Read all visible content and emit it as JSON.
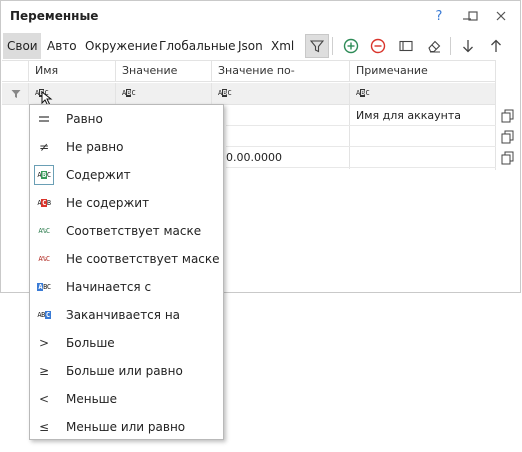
{
  "window": {
    "title": "Переменные",
    "help": "?",
    "colors": {
      "accent": "#2e8b57",
      "danger": "#d9342b",
      "pressed": "#dedede"
    }
  },
  "tabs": [
    "Свои",
    "Авто",
    "Окружение",
    "Глобальные",
    "Json",
    "Xml"
  ],
  "columns": [
    "Имя",
    "Значение",
    "Значение по-умолчанию",
    "Примечание"
  ],
  "rows": [
    {
      "default": "",
      "note": "Имя для аккаунта"
    },
    {
      "default": "",
      "note": ""
    },
    {
      "default": "0.00.0000",
      "note": ""
    }
  ],
  "menu": [
    {
      "icon": "equals-icon",
      "glyph": "═",
      "label": "Равно"
    },
    {
      "icon": "not-equals-icon",
      "glyph": "≠",
      "label": "Не равно"
    },
    {
      "icon": "contains-icon",
      "glyph": "ABC",
      "label": "Содержит"
    },
    {
      "icon": "not-contains-icon",
      "glyph": "ABC",
      "label": "Не содержит"
    },
    {
      "icon": "mask-icon",
      "glyph": "A%C",
      "label": "Соответствует маске"
    },
    {
      "icon": "not-mask-icon",
      "glyph": "A%C",
      "label": "Не соответствует маске"
    },
    {
      "icon": "starts-with-icon",
      "glyph": "ABC",
      "label": "Начинается с"
    },
    {
      "icon": "ends-with-icon",
      "glyph": "ABC",
      "label": "Заканчивается на"
    },
    {
      "icon": "greater-icon",
      "glyph": ">",
      "label": "Больше"
    },
    {
      "icon": "greater-equal-icon",
      "glyph": "≥",
      "label": "Больше или равно"
    },
    {
      "icon": "less-icon",
      "glyph": "<",
      "label": "Меньше"
    },
    {
      "icon": "less-equal-icon",
      "glyph": "≤",
      "label": "Меньше или равно"
    }
  ]
}
